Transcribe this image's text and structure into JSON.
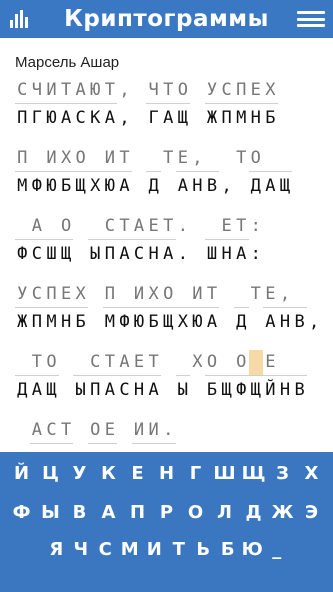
{
  "header": {
    "title": "Криптограммы",
    "left_icon": "stats-icon",
    "right_icon": "menu-icon"
  },
  "puzzle": {
    "author": "Марсель Ашар",
    "lines": [
      {
        "plain": "СЧИТАЮТ, ЧТО УСПЕХ",
        "cipher": "ПГЮАСКА, ГАЩ ЖПМНБ"
      },
      {
        "plain": "П ИХО ИТ  ТЕ,  ТО",
        "cipher": "МФЮБЩХЮА Д АНВ, ДАЩ"
      },
      {
        "plain": " А О  СТАЕТ.  ЕТ:",
        "cipher": "ФСШЩ ЫПАСНА. ШНА:"
      },
      {
        "plain": "УСПЕХ П ИХО ИТ  ТЕ,",
        "cipher": "ЖПМНБ МФЮБЩХЮА Д АНВ,"
      },
      {
        "plain": " ТО  СТАЕТ  ХО О Е",
        "cipher": "ДАЩ ЫПАСНА Ы БЩФЩЙНВ"
      },
      {
        "plain": " АСТ ОЕ ИИ.",
        "cipher": ""
      }
    ],
    "selected": {
      "line": 4,
      "index": 16
    }
  },
  "keyboard": {
    "rows": [
      [
        "Й",
        "Ц",
        "У",
        "К",
        "Е",
        "Н",
        "Г",
        "Ш",
        "Щ",
        "З",
        "Х"
      ],
      [
        "Ф",
        "Ы",
        "В",
        "А",
        "П",
        "Р",
        "О",
        "Л",
        "Д",
        "Ж",
        "Э"
      ],
      [
        "Я",
        "Ч",
        "С",
        "М",
        "И",
        "Т",
        "Ь",
        "Б",
        "Ю",
        "_"
      ]
    ]
  },
  "colors": {
    "header_bg": "#3a78c4",
    "keyboard_bg": "#3a77c0",
    "selected_cell": "#f7d9a8"
  }
}
